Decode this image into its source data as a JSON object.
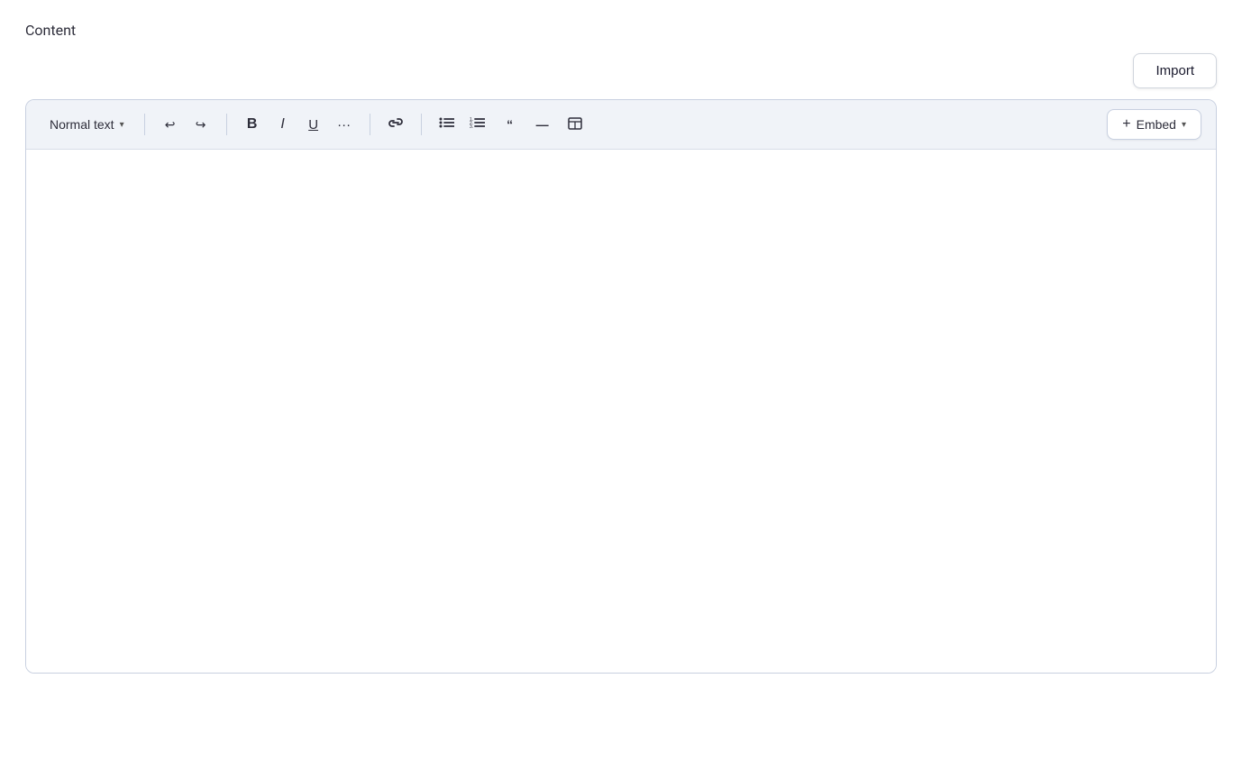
{
  "page": {
    "title": "Content"
  },
  "header": {
    "import_label": "Import"
  },
  "toolbar": {
    "text_style_label": "Normal text",
    "undo_label": "↩",
    "redo_label": "↪",
    "bold_label": "B",
    "italic_label": "I",
    "underline_label": "U",
    "more_label": "···",
    "link_label": "🔗",
    "bullet_list_label": "≡",
    "ordered_list_label": "≡",
    "quote_label": "❝",
    "hr_label": "—",
    "table_label": "⊞",
    "embed_label": "Embed"
  },
  "editor": {
    "content": ""
  }
}
